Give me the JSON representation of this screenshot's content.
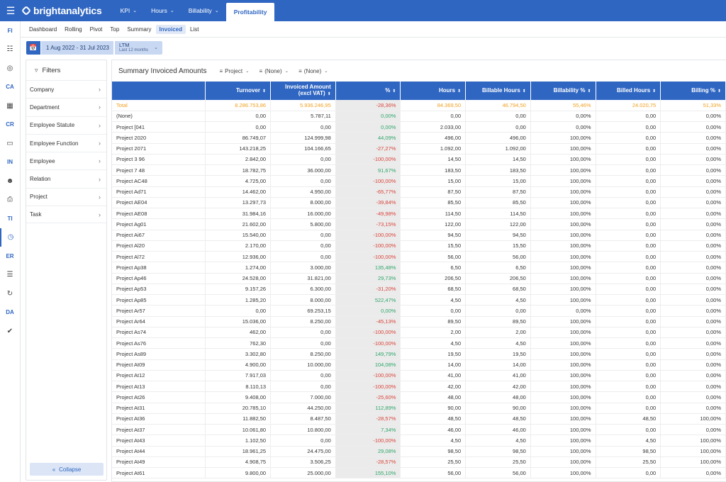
{
  "app": {
    "brand": "brightanalytics"
  },
  "topnav": [
    {
      "label": "KPI",
      "has_menu": true,
      "active": false
    },
    {
      "label": "Hours",
      "has_menu": true,
      "active": false
    },
    {
      "label": "Billability",
      "has_menu": true,
      "active": false
    },
    {
      "label": "Profitability",
      "has_menu": false,
      "active": true
    }
  ],
  "rail": [
    {
      "label": "FI"
    },
    {
      "icon": "grid-icon"
    },
    {
      "icon": "globe-icon"
    },
    {
      "label": "CA"
    },
    {
      "icon": "building-icon"
    },
    {
      "label": "CR"
    },
    {
      "icon": "money-icon"
    },
    {
      "label": "IN"
    },
    {
      "icon": "face-icon"
    },
    {
      "icon": "document-dollar-icon"
    },
    {
      "label": "TI"
    },
    {
      "icon": "clock-icon",
      "active": true
    },
    {
      "label": "ER"
    },
    {
      "icon": "report-icon"
    },
    {
      "icon": "refresh-icon"
    },
    {
      "label": "DA"
    },
    {
      "icon": "check-badge-icon"
    }
  ],
  "subnav": [
    {
      "label": "Dashboard"
    },
    {
      "label": "Rolling"
    },
    {
      "label": "Pivot"
    },
    {
      "label": "Top"
    },
    {
      "label": "Summary"
    },
    {
      "label": "Invoiced",
      "active": true
    },
    {
      "label": "List"
    }
  ],
  "date": {
    "range": "1 Aug 2022 - 31 Jul 2023",
    "period": "LTM",
    "period_sub": "Last 12 months"
  },
  "filters": {
    "title": "Filters",
    "items": [
      "Company",
      "Department",
      "Employee Statute",
      "Employee Function",
      "Employee",
      "Relation",
      "Project",
      "Task"
    ],
    "collapse_label": "Collapse"
  },
  "main": {
    "title": "Summary Invoiced Amounts",
    "groupings": [
      "Project",
      "(None)",
      "(None)"
    ],
    "columns": [
      "",
      "Turnover",
      "Invoiced Amount (excl VAT)",
      "%",
      "Hours",
      "Billable Hours",
      "Billability %",
      "Billed Hours",
      "Billing %"
    ],
    "rows": [
      [
        "Total",
        "8.286.753,86",
        "5.936.246,95",
        "-28,36%",
        "84.369,50",
        "46.794,50",
        "55,46%",
        "24.020,75",
        "51,33%"
      ],
      [
        "(None)",
        "0,00",
        "5.787,11",
        "0,00%",
        "0,00",
        "0,00",
        "0,00%",
        "0,00",
        "0,00%"
      ],
      [
        "Project [041",
        "0,00",
        "0,00",
        "0,00%",
        "2.033,00",
        "0,00",
        "0,00%",
        "0,00",
        "0,00%"
      ],
      [
        "Project 2020",
        "86.749,07",
        "124.999,98",
        "44,09%",
        "496,00",
        "496,00",
        "100,00%",
        "0,00",
        "0,00%"
      ],
      [
        "Project 2071",
        "143.218,25",
        "104.166,65",
        "-27,27%",
        "1.092,00",
        "1.092,00",
        "100,00%",
        "0,00",
        "0,00%"
      ],
      [
        "Project 3 96",
        "2.842,00",
        "0,00",
        "-100,00%",
        "14,50",
        "14,50",
        "100,00%",
        "0,00",
        "0,00%"
      ],
      [
        "Project 7 48",
        "18.782,75",
        "36.000,00",
        "91,67%",
        "183,50",
        "183,50",
        "100,00%",
        "0,00",
        "0,00%"
      ],
      [
        "Project AC48",
        "4.725,00",
        "0,00",
        "-100,00%",
        "15,00",
        "15,00",
        "100,00%",
        "0,00",
        "0,00%"
      ],
      [
        "Project Ad71",
        "14.462,00",
        "4.950,00",
        "-65,77%",
        "87,50",
        "87,50",
        "100,00%",
        "0,00",
        "0,00%"
      ],
      [
        "Project AE04",
        "13.297,73",
        "8.000,00",
        "-39,84%",
        "85,50",
        "85,50",
        "100,00%",
        "0,00",
        "0,00%"
      ],
      [
        "Project AE08",
        "31.984,16",
        "16.000,00",
        "-49,98%",
        "114,50",
        "114,50",
        "100,00%",
        "0,00",
        "0,00%"
      ],
      [
        "Project Ag01",
        "21.602,00",
        "5.800,00",
        "-73,15%",
        "122,00",
        "122,00",
        "100,00%",
        "0,00",
        "0,00%"
      ],
      [
        "Project Ai67",
        "15.540,00",
        "0,00",
        "-100,00%",
        "94,50",
        "94,50",
        "100,00%",
        "0,00",
        "0,00%"
      ],
      [
        "Project Al20",
        "2.170,00",
        "0,00",
        "-100,00%",
        "15,50",
        "15,50",
        "100,00%",
        "0,00",
        "0,00%"
      ],
      [
        "Project Al72",
        "12.936,00",
        "0,00",
        "-100,00%",
        "56,00",
        "56,00",
        "100,00%",
        "0,00",
        "0,00%"
      ],
      [
        "Project Ap38",
        "1.274,00",
        "3.000,00",
        "135,48%",
        "6,50",
        "6,50",
        "100,00%",
        "0,00",
        "0,00%"
      ],
      [
        "Project Ap46",
        "24.528,00",
        "31.821,00",
        "29,73%",
        "206,50",
        "206,50",
        "100,00%",
        "0,00",
        "0,00%"
      ],
      [
        "Project Ap53",
        "9.157,26",
        "6.300,00",
        "-31,20%",
        "68,50",
        "68,50",
        "100,00%",
        "0,00",
        "0,00%"
      ],
      [
        "Project Ap85",
        "1.285,20",
        "8.000,00",
        "522,47%",
        "4,50",
        "4,50",
        "100,00%",
        "0,00",
        "0,00%"
      ],
      [
        "Project Ar57",
        "0,00",
        "69.253,15",
        "0,00%",
        "0,00",
        "0,00",
        "0,00%",
        "0,00",
        "0,00%"
      ],
      [
        "Project Ar64",
        "15.036,00",
        "8.250,00",
        "-45,13%",
        "89,50",
        "89,50",
        "100,00%",
        "0,00",
        "0,00%"
      ],
      [
        "Project As74",
        "462,00",
        "0,00",
        "-100,00%",
        "2,00",
        "2,00",
        "100,00%",
        "0,00",
        "0,00%"
      ],
      [
        "Project As76",
        "762,30",
        "0,00",
        "-100,00%",
        "4,50",
        "4,50",
        "100,00%",
        "0,00",
        "0,00%"
      ],
      [
        "Project As89",
        "3.302,80",
        "8.250,00",
        "149,79%",
        "19,50",
        "19,50",
        "100,00%",
        "0,00",
        "0,00%"
      ],
      [
        "Project At09",
        "4.900,00",
        "10.000,00",
        "104,08%",
        "14,00",
        "14,00",
        "100,00%",
        "0,00",
        "0,00%"
      ],
      [
        "Project At12",
        "7.917,03",
        "0,00",
        "-100,00%",
        "41,00",
        "41,00",
        "100,00%",
        "0,00",
        "0,00%"
      ],
      [
        "Project At13",
        "8.110,13",
        "0,00",
        "-100,00%",
        "42,00",
        "42,00",
        "100,00%",
        "0,00",
        "0,00%"
      ],
      [
        "Project At26",
        "9.408,00",
        "7.000,00",
        "-25,60%",
        "48,00",
        "48,00",
        "100,00%",
        "0,00",
        "0,00%"
      ],
      [
        "Project At31",
        "20.785,10",
        "44.250,00",
        "112,89%",
        "90,00",
        "90,00",
        "100,00%",
        "0,00",
        "0,00%"
      ],
      [
        "Project At36",
        "11.882,50",
        "8.487,50",
        "-28,57%",
        "48,50",
        "48,50",
        "100,00%",
        "48,50",
        "100,00%"
      ],
      [
        "Project At37",
        "10.061,80",
        "10.800,00",
        "7,34%",
        "46,00",
        "46,00",
        "100,00%",
        "0,00",
        "0,00%"
      ],
      [
        "Project At43",
        "1.102,50",
        "0,00",
        "-100,00%",
        "4,50",
        "4,50",
        "100,00%",
        "4,50",
        "100,00%"
      ],
      [
        "Project At44",
        "18.961,25",
        "24.475,00",
        "29,08%",
        "98,50",
        "98,50",
        "100,00%",
        "98,50",
        "100,00%"
      ],
      [
        "Project At49",
        "4.908,75",
        "3.506,25",
        "-28,57%",
        "25,50",
        "25,50",
        "100,00%",
        "25,50",
        "100,00%"
      ],
      [
        "Project At61",
        "9.800,00",
        "25.000,00",
        "155,10%",
        "56,00",
        "56,00",
        "100,00%",
        "0,00",
        "0,00%"
      ]
    ]
  }
}
